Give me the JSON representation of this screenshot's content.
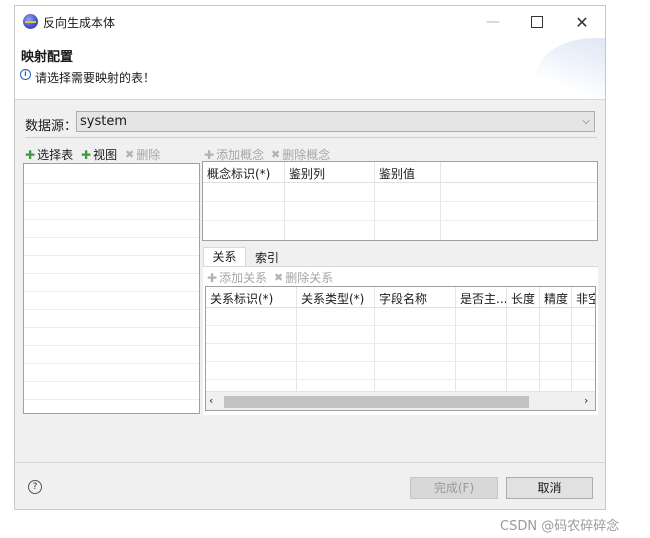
{
  "window": {
    "title": "反向生成本体",
    "controls": {
      "minimize": "—",
      "maximize": "☐",
      "close": "✕"
    }
  },
  "header": {
    "title": "映射配置",
    "message": "请选择需要映射的表！",
    "info_icon": "ⓘ"
  },
  "datasource": {
    "label": "数据源：",
    "value": "system"
  },
  "left_toolbar": {
    "select_table": "选择表",
    "view": "视图",
    "delete": "删除"
  },
  "concept_toolbar": {
    "add_concept": "添加概念",
    "delete_concept": "删除概念"
  },
  "concept_table": {
    "columns": [
      "概念标识(*)",
      "鉴别列",
      "鉴别值"
    ]
  },
  "tabs": [
    {
      "label": "关系"
    },
    {
      "label": "索引"
    }
  ],
  "relation_toolbar": {
    "add_relation": "添加关系",
    "delete_relation": "删除关系"
  },
  "relation_table": {
    "columns": [
      "关系标识(*)",
      "关系类型(*)",
      "字段名称",
      "是否主...",
      "长度",
      "精度",
      "非空"
    ]
  },
  "footer": {
    "help_icon": "?",
    "finish": "完成(F)",
    "cancel": "取消"
  },
  "watermark": "CSDN @码农碎碎念"
}
